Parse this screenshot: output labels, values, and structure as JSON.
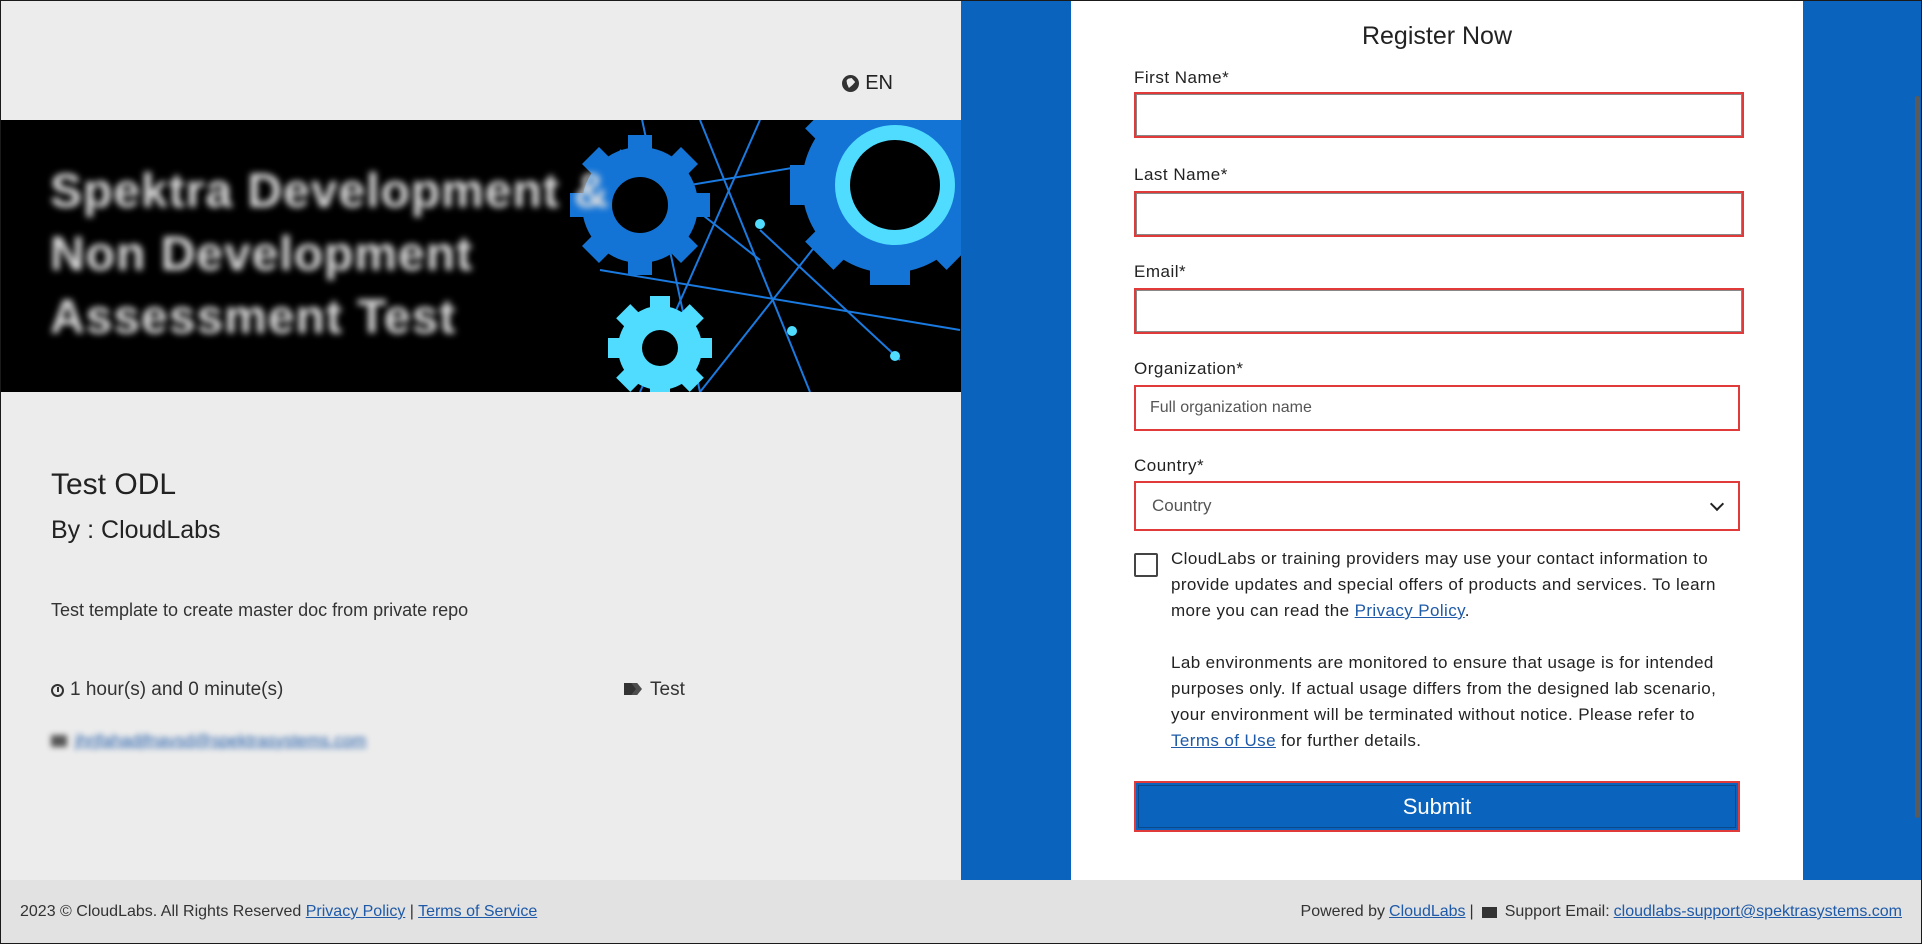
{
  "header": {
    "language": "EN"
  },
  "banner": {
    "title": "Spektra Development & Non Development Assessment Test"
  },
  "course": {
    "title": "Test ODL",
    "author": "By : CloudLabs",
    "description": "Test template to create master doc from private repo",
    "duration": "1 hour(s) and 0 minute(s)",
    "tag": "Test",
    "contact_email": "jhrjfahadjfnavsd@spektrasystems.com"
  },
  "form": {
    "title": "Register Now",
    "first_name_label": "First Name*",
    "first_name_value": "",
    "last_name_label": "Last Name*",
    "last_name_value": "",
    "email_label": "Email*",
    "email_value": "",
    "organization_label": "Organization*",
    "organization_placeholder": "Full organization name",
    "country_label": "Country*",
    "country_selected": "Country",
    "consent_text_1": "CloudLabs or training providers may use your contact information to provide updates and special offers of products and services. To learn more you can read the ",
    "consent_privacy_link": "Privacy Policy",
    "consent_text_1_end": ".",
    "consent_text_2": "Lab environments are monitored to ensure that usage is for intended purposes only. If actual usage differs from the designed lab scenario, your environment will be terminated without notice. Please refer to ",
    "consent_terms_link": "Terms of Use",
    "consent_text_2_end": " for further details.",
    "submit_label": "Submit"
  },
  "footer": {
    "copyright": "2023 © CloudLabs. All Rights Reserved ",
    "privacy_link": "Privacy Policy",
    "separator": " | ",
    "terms_link": "Terms of Service",
    "powered_by": "Powered by ",
    "cloudlabs_link": "CloudLabs",
    "support_label": "Support Email:",
    "support_email": "cloudlabs-support@spektrasystems.com"
  },
  "colors": {
    "brand_blue": "#0a63bd",
    "error_red": "#e03a3a",
    "link": "#1e5aa8"
  },
  "icons": [
    "globe-icon",
    "clock-icon",
    "tags-icon",
    "envelope-icon",
    "chevron-down-icon"
  ]
}
